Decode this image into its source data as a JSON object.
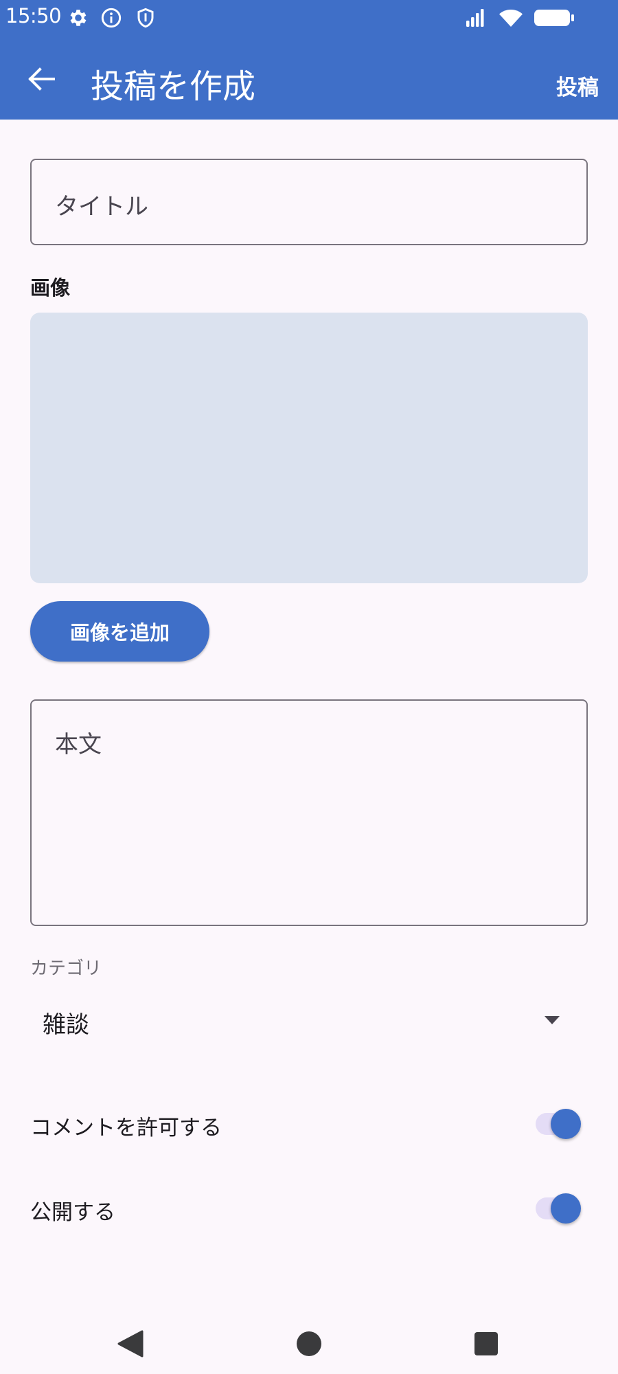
{
  "status_bar": {
    "time": "15:50",
    "left_icons": [
      "gear-icon",
      "info-icon",
      "shield-icon"
    ],
    "right_icons": [
      "signal-icon",
      "wifi-icon",
      "battery-icon"
    ]
  },
  "app_bar": {
    "title": "投稿を作成",
    "action_label": "投稿",
    "back_icon": "arrow-back-icon"
  },
  "form": {
    "title_placeholder": "タイトル",
    "image_section_label": "画像",
    "add_image_button": "画像を追加",
    "body_placeholder": "本文",
    "category_label": "カテゴリ",
    "category_value": "雑談",
    "toggles": [
      {
        "label": "コメントを許可する",
        "on": true
      },
      {
        "label": "公開する",
        "on": true
      }
    ]
  },
  "nav_bar": {
    "buttons": [
      "back-triangle-icon",
      "home-circle-icon",
      "recents-square-icon"
    ]
  },
  "colors": {
    "primary": "#3f6fc8",
    "background": "#fcf7fc",
    "image_placeholder": "#dbe2ef",
    "switch_track": "#e4dcf6"
  }
}
